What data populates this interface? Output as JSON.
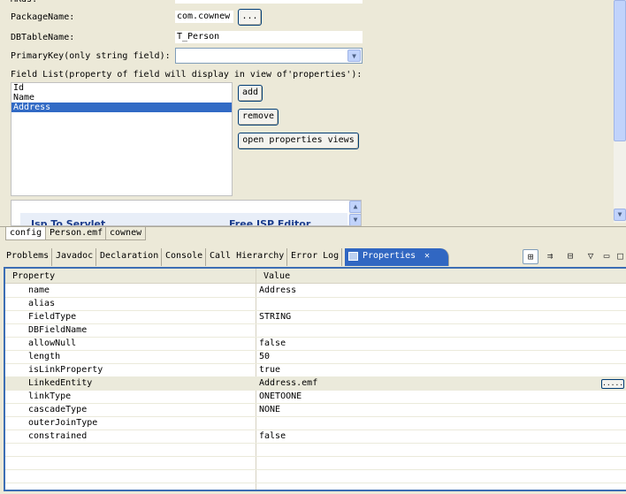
{
  "editor": {
    "labels": {
      "package_name": "PackageName:",
      "db_table_name": "DBTableName:",
      "primary_key": "PrimaryKey(only string field):",
      "field_list": "Field List(property of field will display in view of'properties'):"
    },
    "values": {
      "package_name": "com.cownew",
      "db_table_name": "T_Person",
      "primary_key": ""
    },
    "browse_button": "...",
    "fields": [
      "Id",
      "Name",
      "Address"
    ],
    "selected_field": "Address",
    "buttons": {
      "add": "add",
      "remove": "remove",
      "open_properties": "open properties views"
    },
    "embedded_links": [
      "Jsp To Servlet",
      "Free JSP Editor"
    ]
  },
  "editor_tabs": [
    "config",
    "Person.emf",
    "cownew"
  ],
  "view_tabs": [
    "Problems",
    "Javadoc",
    "Declaration",
    "Console",
    "Call Hierarchy",
    "Error Log",
    "Properties"
  ],
  "active_view_tab": "Properties",
  "close_glyph": "✕",
  "properties": {
    "headers": {
      "property": "Property",
      "value": "Value"
    },
    "rows": [
      {
        "name": "name",
        "value": "Address"
      },
      {
        "name": "alias",
        "value": ""
      },
      {
        "name": "FieldType",
        "value": "STRING"
      },
      {
        "name": "DBFieldName",
        "value": ""
      },
      {
        "name": "allowNull",
        "value": "false"
      },
      {
        "name": "length",
        "value": "50"
      },
      {
        "name": "isLinkProperty",
        "value": "true"
      },
      {
        "name": "LinkedEntity",
        "value": "Address.emf"
      },
      {
        "name": "linkType",
        "value": "ONETOONE"
      },
      {
        "name": "cascadeType",
        "value": "NONE"
      },
      {
        "name": "outerJoinType",
        "value": ""
      },
      {
        "name": "constrained",
        "value": "false"
      }
    ],
    "editing_row": "LinkedEntity",
    "ellipsis_label": "....."
  },
  "colors": {
    "window_bg": "#ece9d8",
    "selection": "#316ac5",
    "active_tab": "#3167c2",
    "panel_border": "#3c6eb4"
  }
}
